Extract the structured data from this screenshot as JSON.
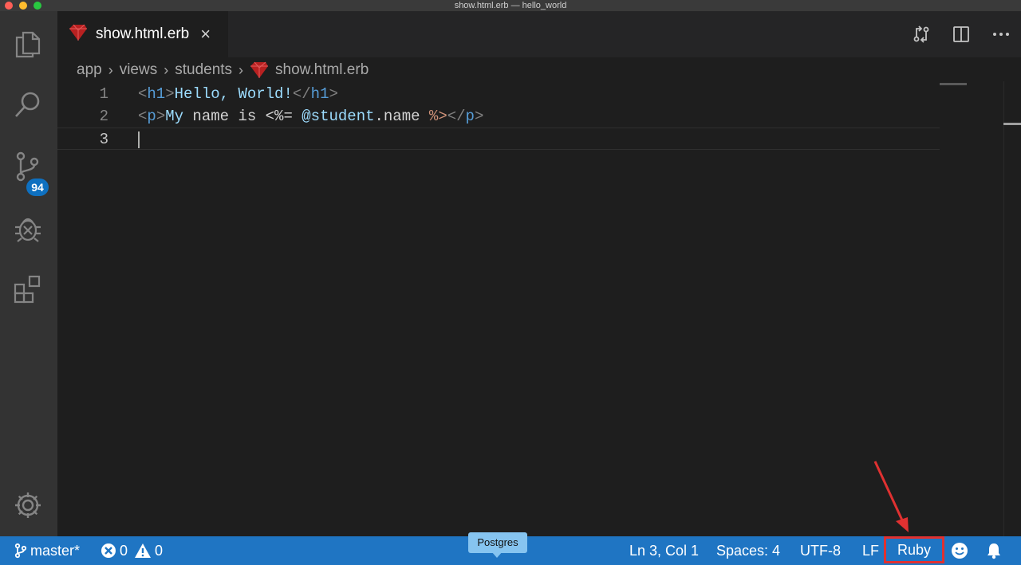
{
  "window": {
    "title": "show.html.erb — hello_world"
  },
  "activity_bar": {
    "items": [
      {
        "icon": "files-icon"
      },
      {
        "icon": "search-icon"
      },
      {
        "icon": "source-control-icon",
        "badge": "94"
      },
      {
        "icon": "debug-icon"
      },
      {
        "icon": "extensions-icon"
      },
      {
        "icon": "gear-icon"
      }
    ]
  },
  "tab": {
    "name": "show.html.erb",
    "close": "×"
  },
  "breadcrumb": [
    "app",
    "views",
    "students",
    "show.html.erb"
  ],
  "editor": {
    "lines": [
      {
        "number": "1",
        "parts": [
          "<",
          "h1",
          ">",
          "Hello, World!",
          "</",
          "h1",
          ">"
        ]
      },
      {
        "number": "2",
        "parts": [
          "<",
          "p",
          ">",
          "My",
          " name is ",
          "<%=",
          " ",
          "@student",
          ".name ",
          "%>",
          "</",
          "p",
          ">"
        ]
      },
      {
        "number": "3"
      }
    ],
    "cursor": {
      "line": 3,
      "col": 1
    }
  },
  "statusbar": {
    "branch": "master*",
    "errors": "0",
    "warnings": "0",
    "tooltip": "Postgres",
    "position": "Ln 3, Col 1",
    "spaces": "Spaces: 4",
    "encoding": "UTF-8",
    "eol": "LF",
    "language": "Ruby"
  },
  "colors": {
    "statusbar": "#1f75c3",
    "highlight_box": "#e03131",
    "badge": "#0e70c0"
  }
}
